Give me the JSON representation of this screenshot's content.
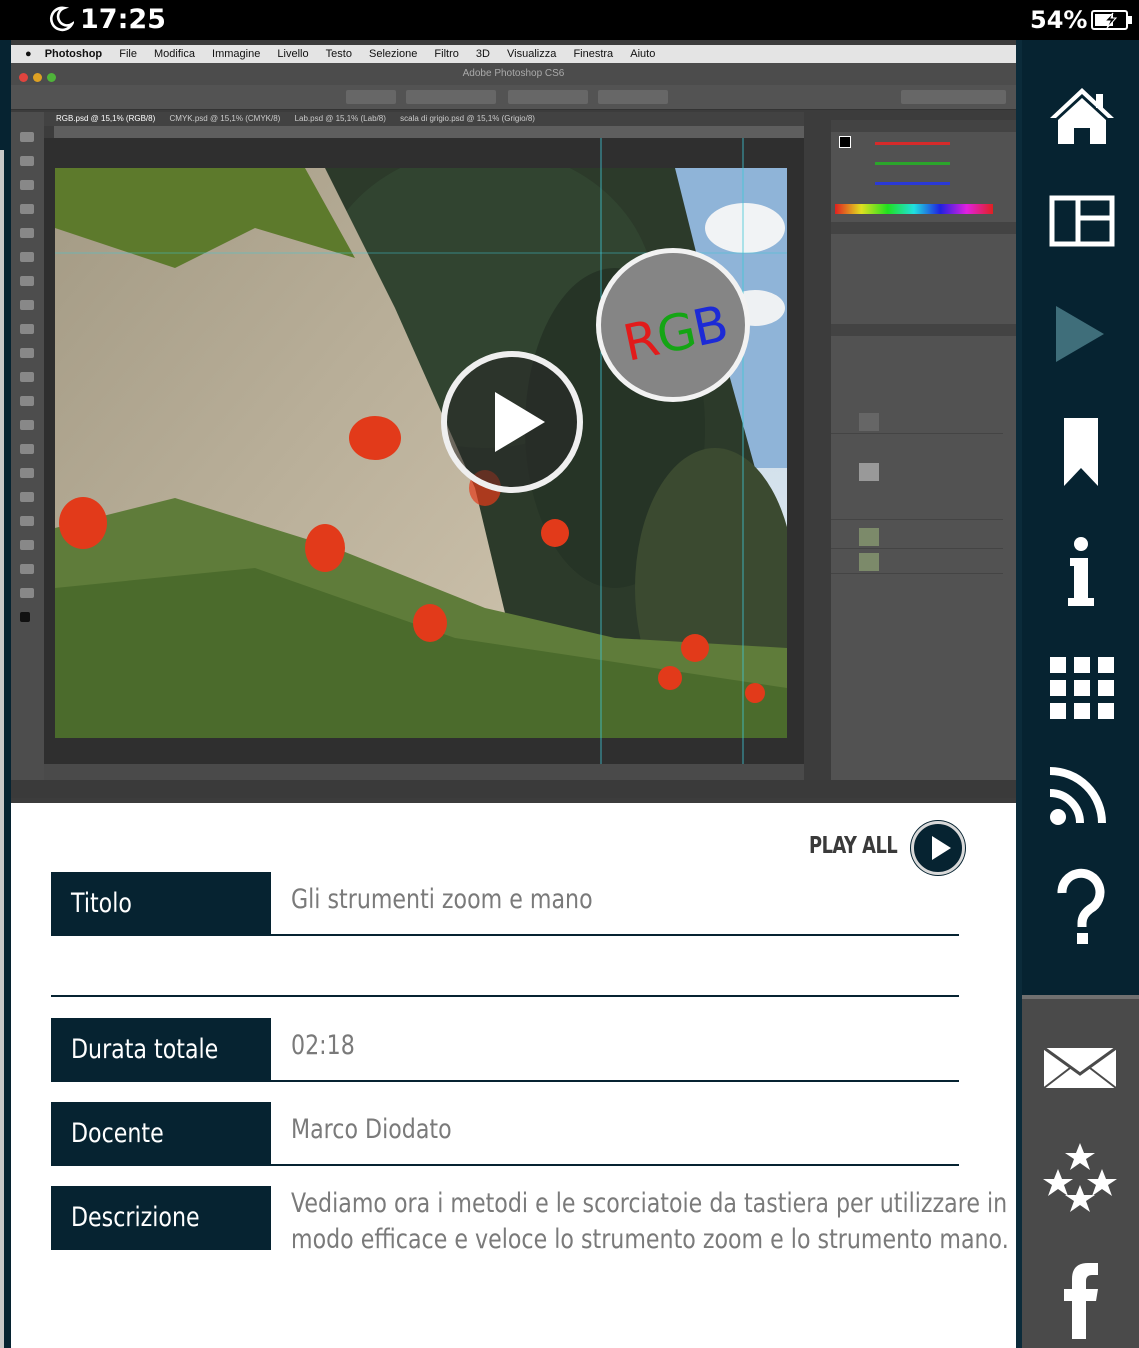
{
  "status_bar": {
    "time": "17:25",
    "battery": "54%"
  },
  "video": {
    "ps_app": "Photoshop",
    "ps_menus": [
      "File",
      "Modifica",
      "Immagine",
      "Livello",
      "Testo",
      "Selezione",
      "Filtro",
      "3D",
      "Visualizza",
      "Finestra",
      "Aiuto"
    ],
    "ps_window_title": "Adobe Photoshop CS6",
    "ps_tabs": [
      "RGB.psd @ 15,1% (RGB/8)",
      "CMYK.psd @ 15,1% (CMYK/8)",
      "Lab.psd @ 15,1% (Lab/8)",
      "scala di grigio.psd @ 15,1% (Grigio/8)"
    ],
    "badge_text": "RGB"
  },
  "info": {
    "play_all": "PLAY ALL",
    "rows": [
      {
        "label": "Titolo",
        "value": "Gli strumenti zoom e mano"
      },
      {
        "label": "Durata totale",
        "value": "02:18"
      },
      {
        "label": "Docente",
        "value": "Marco Diodato"
      },
      {
        "label": "Descrizione",
        "value_line1": "Vediamo ora i metodi e le scorciatoie da tastiera per utilizzare in",
        "value_line2": "modo efficace e veloce lo strumento zoom e lo strumento mano."
      }
    ]
  },
  "sidebar": {
    "icons": [
      "home-icon",
      "layout-icon",
      "play-icon",
      "bookmark-icon",
      "info-icon",
      "grid-icon",
      "rss-icon",
      "help-icon",
      "mail-icon",
      "stars-icon",
      "facebook-icon"
    ],
    "accent": "#062331"
  }
}
